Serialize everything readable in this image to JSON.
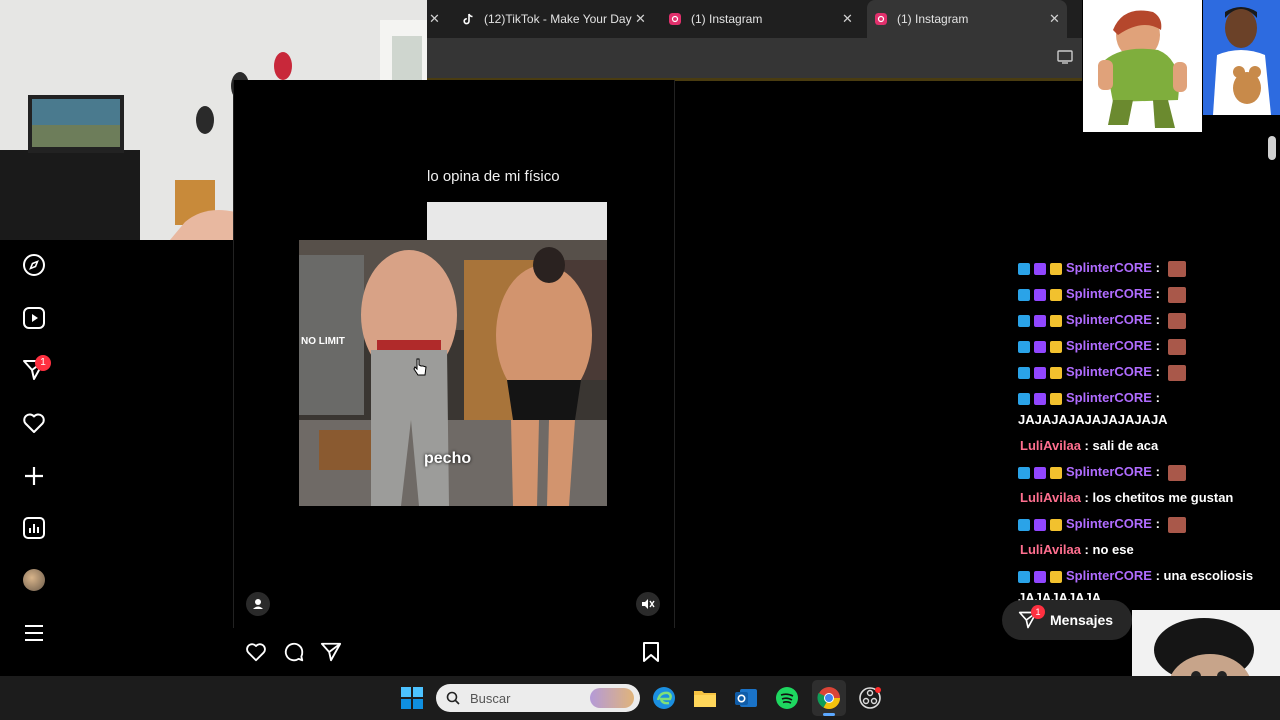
{
  "tabs": [
    {
      "label": "(12)TikTok - Make Your Day",
      "icon": "tiktok-icon"
    },
    {
      "label": "(1) Instagram",
      "icon": "instagram-icon"
    },
    {
      "label": "(1) Instagram",
      "icon": "instagram-icon"
    }
  ],
  "post": {
    "caption": "lo opina de mi físico",
    "video_text": "pecho",
    "overlay_text": "NO LIMIT"
  },
  "nav": {
    "notification_badge": "1"
  },
  "messages": {
    "label": "Mensajes",
    "badge": "1"
  },
  "chat": [
    {
      "user": "SplinterCORE",
      "sep": ":",
      "msg": "",
      "emote": true,
      "color": "purple",
      "badges": true
    },
    {
      "user": "SplinterCORE",
      "sep": ":",
      "msg": "",
      "emote": true,
      "color": "purple",
      "badges": true
    },
    {
      "user": "SplinterCORE",
      "sep": ":",
      "msg": "",
      "emote": true,
      "color": "purple",
      "badges": true
    },
    {
      "user": "SplinterCORE",
      "sep": ":",
      "msg": "",
      "emote": true,
      "color": "purple",
      "badges": true
    },
    {
      "user": "SplinterCORE",
      "sep": ":",
      "msg": "",
      "emote": true,
      "color": "purple",
      "badges": true
    },
    {
      "user": "SplinterCORE",
      "sep": ":",
      "msg": "",
      "emote": false,
      "color": "purple",
      "badges": true
    },
    {
      "user": "",
      "sep": "",
      "msg": "JAJAJAJAJAJAJAJAJA",
      "emote": false,
      "color": "white",
      "badges": false
    },
    {
      "user": "LuliAvilaa",
      "sep": ":",
      "msg": "sali de aca",
      "emote": false,
      "color": "pink",
      "badges": false
    },
    {
      "user": "SplinterCORE",
      "sep": ":",
      "msg": "",
      "emote": true,
      "color": "purple",
      "badges": true
    },
    {
      "user": "LuliAvilaa",
      "sep": ":",
      "msg": "los chetitos me gustan",
      "emote": false,
      "color": "pink",
      "badges": false
    },
    {
      "user": "SplinterCORE",
      "sep": ":",
      "msg": "",
      "emote": true,
      "color": "purple",
      "badges": true
    },
    {
      "user": "LuliAvilaa",
      "sep": ":",
      "msg": "no ese",
      "emote": false,
      "color": "pink",
      "badges": false
    },
    {
      "user": "SplinterCORE",
      "sep": ":",
      "msg": "una escoliosis",
      "emote": false,
      "color": "purple",
      "badges": true
    },
    {
      "user": "",
      "sep": "",
      "msg": "JAJAJAJAJA",
      "emote": false,
      "color": "white",
      "badges": false
    }
  ],
  "taskbar": {
    "search_placeholder": "Buscar"
  },
  "colors": {
    "accent_purple": "#b06cff",
    "accent_pink": "#ff6f8f",
    "badge_red": "#ff3040",
    "taskbar_bg": "#1c1c1c"
  }
}
